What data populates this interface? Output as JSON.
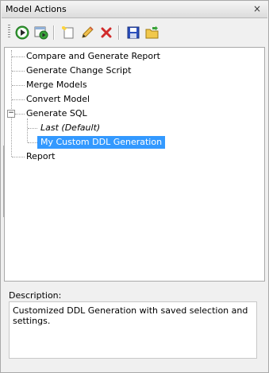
{
  "window": {
    "title": "Model Actions",
    "close_glyph": "×"
  },
  "toolbar": {
    "buttons": [
      {
        "icon": "run-icon"
      },
      {
        "icon": "run-options-icon"
      },
      {
        "icon": "new-icon"
      },
      {
        "icon": "edit-icon"
      },
      {
        "icon": "delete-icon"
      },
      {
        "icon": "save-icon"
      },
      {
        "icon": "open-folder-icon"
      }
    ]
  },
  "tree": {
    "items": [
      {
        "label": "Compare and Generate Report"
      },
      {
        "label": "Generate Change Script"
      },
      {
        "label": "Merge Models"
      },
      {
        "label": "Convert Model"
      },
      {
        "label": "Generate SQL",
        "expander": "−"
      },
      {
        "label": "Last (Default)"
      },
      {
        "label": "My Custom DDL Generation"
      },
      {
        "label": "Report"
      }
    ]
  },
  "description": {
    "label": "Description:",
    "text": "Customized DDL Generation with saved selection and settings."
  }
}
